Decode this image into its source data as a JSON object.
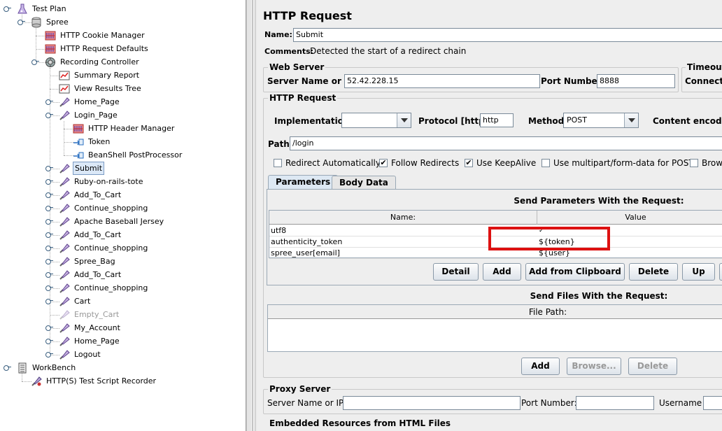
{
  "tree": {
    "nodes": [
      {
        "label": "Test Plan",
        "icon": "test-plan-icon"
      },
      {
        "label": "Spree",
        "icon": "thread-group-icon"
      },
      {
        "label": "HTTP Cookie Manager",
        "icon": "config-element-icon"
      },
      {
        "label": "HTTP Request Defaults",
        "icon": "config-element-icon"
      },
      {
        "label": "Recording Controller",
        "icon": "controller-icon"
      },
      {
        "label": "Summary Report",
        "icon": "listener-icon"
      },
      {
        "label": "View Results Tree",
        "icon": "listener-icon"
      },
      {
        "label": "Home_Page",
        "icon": "sampler-icon"
      },
      {
        "label": "Login_Page",
        "icon": "sampler-icon"
      },
      {
        "label": "HTTP Header Manager",
        "icon": "config-element-icon"
      },
      {
        "label": "Token",
        "icon": "post-processor-icon"
      },
      {
        "label": "BeanShell PostProcessor",
        "icon": "post-processor-icon"
      },
      {
        "label": "Submit",
        "icon": "sampler-icon"
      },
      {
        "label": "Ruby-on-rails-tote",
        "icon": "sampler-icon"
      },
      {
        "label": "Add_To_Cart",
        "icon": "sampler-icon"
      },
      {
        "label": "Continue_shopping",
        "icon": "sampler-icon"
      },
      {
        "label": "Apache Baseball Jersey",
        "icon": "sampler-icon"
      },
      {
        "label": "Add_To_Cart",
        "icon": "sampler-icon"
      },
      {
        "label": "Continue_shopping",
        "icon": "sampler-icon"
      },
      {
        "label": "Spree_Bag",
        "icon": "sampler-icon"
      },
      {
        "label": "Add_To_Cart",
        "icon": "sampler-icon"
      },
      {
        "label": "Continue_shopping",
        "icon": "sampler-icon"
      },
      {
        "label": "Cart",
        "icon": "sampler-icon"
      },
      {
        "label": "Empty_Cart",
        "icon": "sampler-icon"
      },
      {
        "label": "My_Account",
        "icon": "sampler-icon"
      },
      {
        "label": "Home_Page",
        "icon": "sampler-icon"
      },
      {
        "label": "Logout",
        "icon": "sampler-icon"
      },
      {
        "label": "WorkBench",
        "icon": "workbench-icon"
      },
      {
        "label": "HTTP(S) Test Script Recorder",
        "icon": "recorder-icon"
      }
    ]
  },
  "panel": {
    "title": "HTTP Request",
    "name_label": "Name:",
    "name_value": "Submit",
    "comments_label": "Comments:",
    "comments_value": "Detected the start of a redirect chain",
    "web_server": {
      "title": "Web Server",
      "server_label": "Server Name or IP:",
      "server_value": "52.42.228.15",
      "port_label": "Port Number:",
      "port_value": "8888"
    },
    "timeouts": {
      "title": "Timeouts",
      "connect_label": "Connect:"
    },
    "http_request": {
      "title": "HTTP Request",
      "impl_label": "Implementation:",
      "impl_value": "",
      "protocol_label": "Protocol [http]:",
      "protocol_value": "http",
      "method_label": "Method:",
      "method_value": "POST",
      "encoding_label": "Content encoding",
      "path_label": "Path:",
      "path_value": "/login",
      "checkboxes": [
        {
          "label": "Redirect Automatically",
          "checked": false
        },
        {
          "label": "Follow Redirects",
          "checked": true
        },
        {
          "label": "Use KeepAlive",
          "checked": true
        },
        {
          "label": "Use multipart/form-data for POST",
          "checked": false
        },
        {
          "label": "Brow",
          "checked": false
        }
      ],
      "check_mark": "✔"
    },
    "tabs": [
      "Parameters",
      "Body Data"
    ],
    "params": {
      "heading": "Send Parameters With the Request:",
      "col_name": "Name:",
      "col_value": "Value",
      "rows": [
        {
          "name": "utf8",
          "value": "✓"
        },
        {
          "name": "authenticity_token",
          "value": "${token}"
        },
        {
          "name": "spree_user[email]",
          "value": "${user}"
        }
      ],
      "buttons": [
        "Detail",
        "Add",
        "Add from Clipboard",
        "Delete",
        "Up"
      ]
    },
    "files": {
      "heading": "Send Files With the Request:",
      "col_path": "File Path:",
      "buttons": [
        "Add",
        "Browse...",
        "Delete"
      ]
    },
    "proxy": {
      "title": "Proxy Server",
      "server_label": "Server Name or IP:",
      "port_label": "Port Number:",
      "user_label": "Username"
    },
    "embedded": {
      "title": "Embedded Resources from HTML Files"
    },
    "highlight_color": "#dd1111"
  }
}
